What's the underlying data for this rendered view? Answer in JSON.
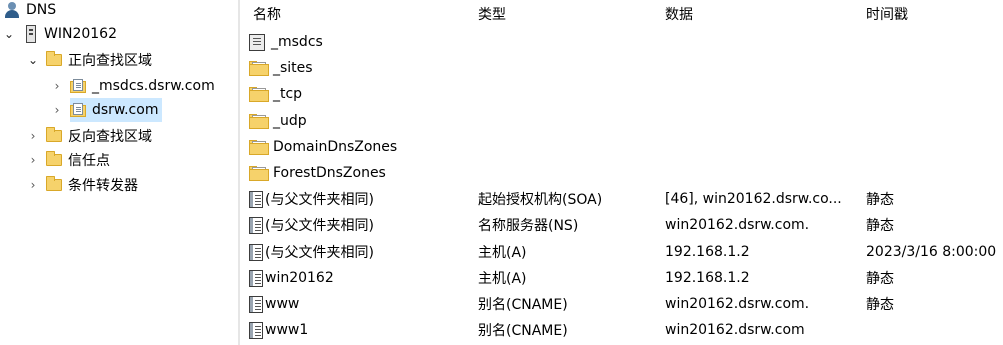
{
  "tree": {
    "root": "DNS",
    "server": "WIN20162",
    "forward_zones": "正向查找区域",
    "zone_msdcs": "_msdcs.dsrw.com",
    "zone_dsrw": "dsrw.com",
    "reverse_zones": "反向查找区域",
    "trust_points": "信任点",
    "forwarders": "条件转发器"
  },
  "columns": {
    "name": "名称",
    "type": "类型",
    "data": "数据",
    "timestamp": "时间戳"
  },
  "records": [
    {
      "icon": "subzone-icon",
      "name": "_msdcs",
      "type": "",
      "data": "",
      "timestamp": ""
    },
    {
      "icon": "folder-icon",
      "name": "_sites",
      "type": "",
      "data": "",
      "timestamp": ""
    },
    {
      "icon": "folder-icon",
      "name": "_tcp",
      "type": "",
      "data": "",
      "timestamp": ""
    },
    {
      "icon": "folder-icon",
      "name": "_udp",
      "type": "",
      "data": "",
      "timestamp": ""
    },
    {
      "icon": "folder-icon",
      "name": "DomainDnsZones",
      "type": "",
      "data": "",
      "timestamp": ""
    },
    {
      "icon": "folder-icon",
      "name": "ForestDnsZones",
      "type": "",
      "data": "",
      "timestamp": ""
    },
    {
      "icon": "record-icon",
      "name": "(与父文件夹相同)",
      "type": "起始授权机构(SOA)",
      "data": "[46], win20162.dsrw.co...",
      "timestamp": "静态"
    },
    {
      "icon": "record-icon",
      "name": "(与父文件夹相同)",
      "type": "名称服务器(NS)",
      "data": "win20162.dsrw.com.",
      "timestamp": "静态"
    },
    {
      "icon": "record-icon",
      "name": "(与父文件夹相同)",
      "type": "主机(A)",
      "data": "192.168.1.2",
      "timestamp": "2023/3/16 8:00:00"
    },
    {
      "icon": "record-icon",
      "name": "win20162",
      "type": "主机(A)",
      "data": "192.168.1.2",
      "timestamp": "静态"
    },
    {
      "icon": "record-icon",
      "name": "www",
      "type": "别名(CNAME)",
      "data": "win20162.dsrw.com.",
      "timestamp": "静态"
    },
    {
      "icon": "record-icon",
      "name": "www1",
      "type": "别名(CNAME)",
      "data": "win20162.dsrw.com",
      "timestamp": ""
    }
  ]
}
